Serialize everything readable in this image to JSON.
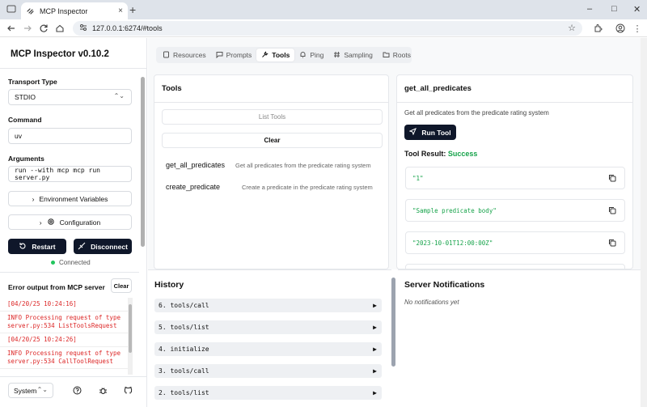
{
  "browser": {
    "tab_title": "MCP Inspector",
    "url": "127.0.0.1:6274/#tools",
    "new_tab_label": "+",
    "close_tab_label": "×",
    "minimize_label": "–",
    "maximize_label": "□",
    "close_window_label": "✕"
  },
  "sidebar": {
    "app_title": "MCP Inspector v0.10.2",
    "transport_label": "Transport Type",
    "transport_value": "STDIO",
    "command_label": "Command",
    "command_value": "uv",
    "arguments_label": "Arguments",
    "arguments_value": "run --with mcp mcp run server.py",
    "env_vars_label": "Environment Variables",
    "config_label": "Configuration",
    "restart_label": "Restart",
    "disconnect_label": "Disconnect",
    "status_text": "Connected",
    "error_title": "Error output from MCP server",
    "clear_label": "Clear",
    "error_log": [
      "[04/20/25 10:24:16]",
      "INFO Processing request of type server.py:534 ListToolsRequest",
      "[04/20/25 10:24:26]",
      "INFO Processing request of type server.py:534 CallToolRequest"
    ],
    "theme_value": "System"
  },
  "main": {
    "tabs": [
      {
        "label": "Resources",
        "icon": "file-icon"
      },
      {
        "label": "Prompts",
        "icon": "message-icon"
      },
      {
        "label": "Tools",
        "icon": "wrench-icon",
        "active": true
      },
      {
        "label": "Ping",
        "icon": "bell-icon"
      },
      {
        "label": "Sampling",
        "icon": "hash-icon"
      },
      {
        "label": "Roots",
        "icon": "folder-icon"
      }
    ],
    "tools_panel": {
      "title": "Tools",
      "list_tools_label": "List Tools",
      "clear_label": "Clear",
      "tools": [
        {
          "name": "get_all_predicates",
          "description": "Get all predicates from the predicate rating system"
        },
        {
          "name": "create_predicate",
          "description": "Create a predicate in the predicate rating system"
        }
      ]
    },
    "detail_panel": {
      "title": "get_all_predicates",
      "description": "Get all predicates from the predicate rating system",
      "run_label": "Run Tool",
      "result_label": "Tool Result:",
      "result_status": "Success",
      "results": [
        "\"1\"",
        "\"Sample predicate body\"",
        "\"2023-10-01T12:00:00Z\""
      ]
    },
    "history": {
      "title": "History",
      "items": [
        "6. tools/call",
        "5. tools/list",
        "4. initialize",
        "3. tools/call",
        "2. tools/list"
      ]
    },
    "notifications": {
      "title": "Server Notifications",
      "empty_text": "No notifications yet"
    }
  },
  "colors": {
    "accent_dark": "#0f172a",
    "success": "#16a34a",
    "error": "#dc2626",
    "connected_dot": "#22c55e"
  }
}
